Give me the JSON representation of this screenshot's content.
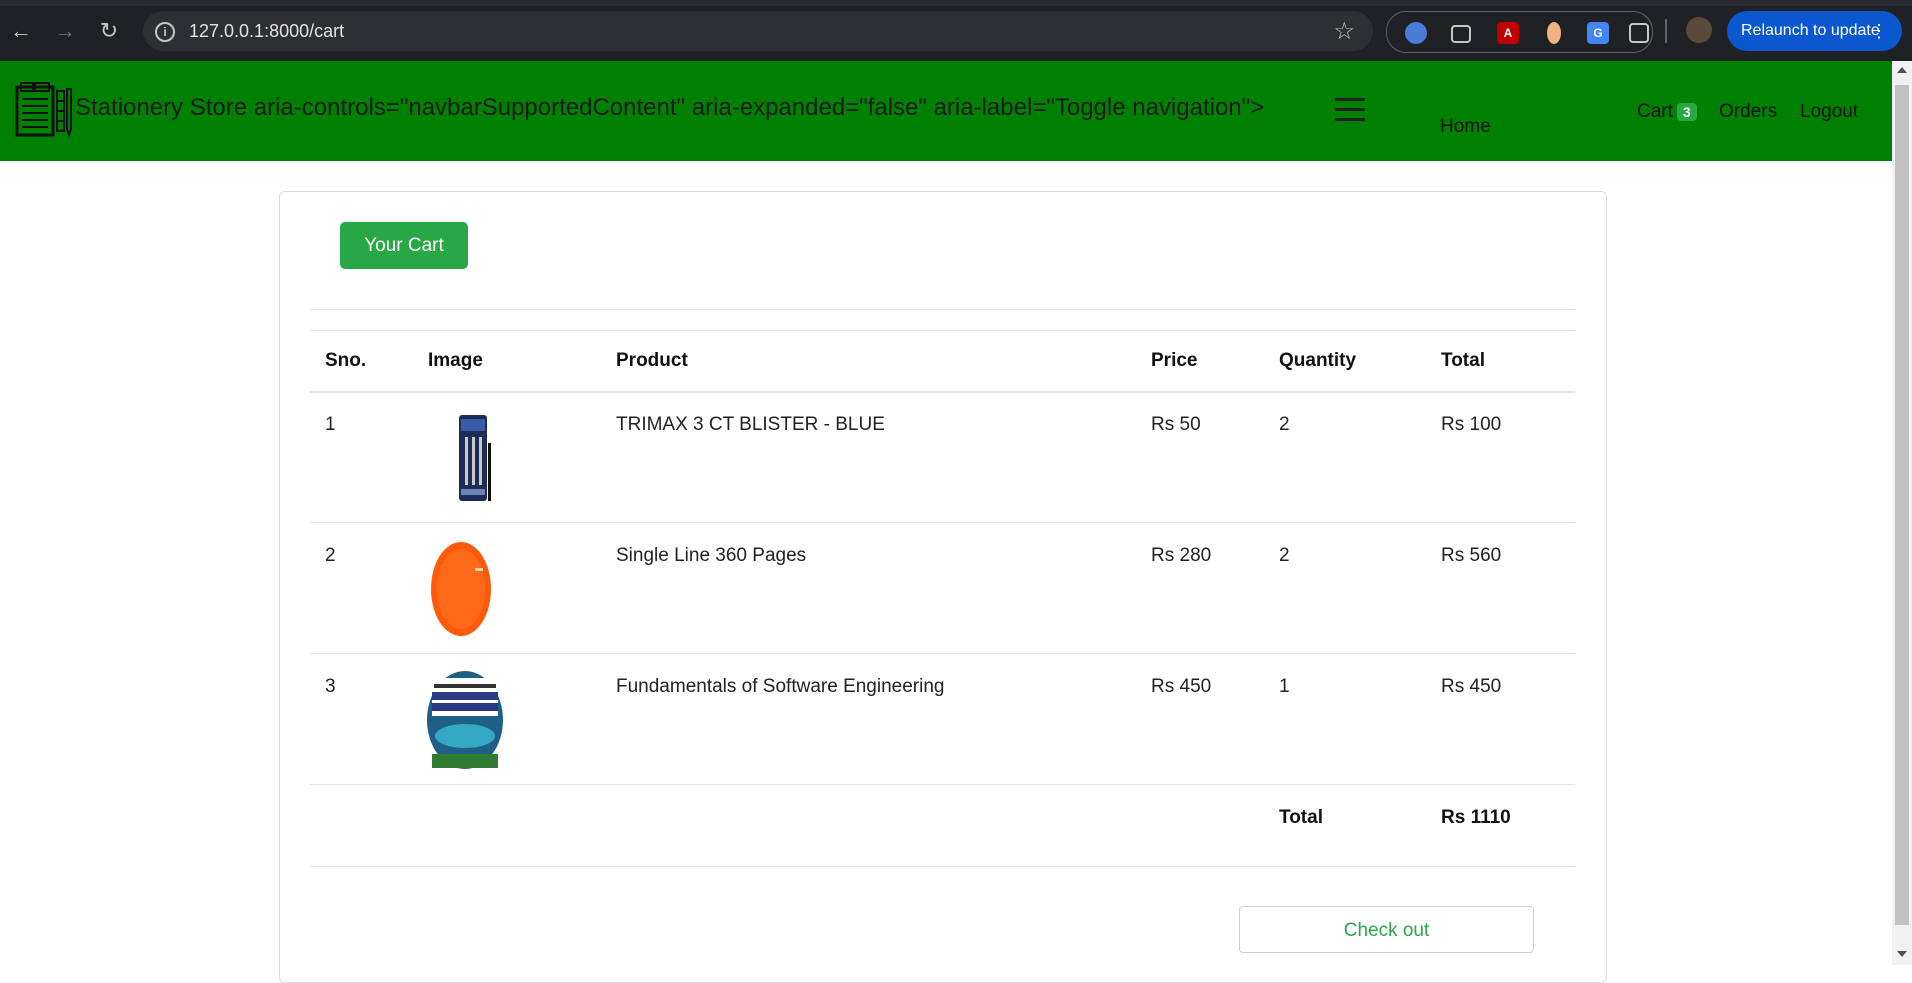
{
  "browser": {
    "url": "127.0.0.1:8000/cart",
    "relaunch_label": "Relaunch to update",
    "back_icon": "←",
    "forward_icon": "→",
    "reload_icon": "↻",
    "star_icon": "☆",
    "menu_icon": "⋮"
  },
  "navbar": {
    "brand_text": "Stationery Store aria-controls=\"navbarSupportedContent\" aria-expanded=\"false\" aria-label=\"Toggle navigation\">",
    "home": "Home",
    "cart": "Cart",
    "cart_count": "3",
    "orders": "Orders",
    "logout": "Logout",
    "background_color": "#008000"
  },
  "cart": {
    "title_button": "Your Cart",
    "columns": [
      "Sno.",
      "Image",
      "Product",
      "Price",
      "Quantity",
      "Total"
    ],
    "rows": [
      {
        "sno": "1",
        "product": "TRIMAX 3 CT BLISTER - BLUE",
        "price": "Rs 50",
        "quantity": "2",
        "total": "Rs 100"
      },
      {
        "sno": "2",
        "product": "Single Line 360 Pages",
        "price": "Rs 280",
        "quantity": "2",
        "total": "Rs 560"
      },
      {
        "sno": "3",
        "product": "Fundamentals of Software Engineering",
        "price": "Rs 450",
        "quantity": "1",
        "total": "Rs 450"
      }
    ],
    "total_label": "Total",
    "total_value": "Rs 1110",
    "checkout_label": "Check out",
    "accent_color": "#28a745"
  }
}
